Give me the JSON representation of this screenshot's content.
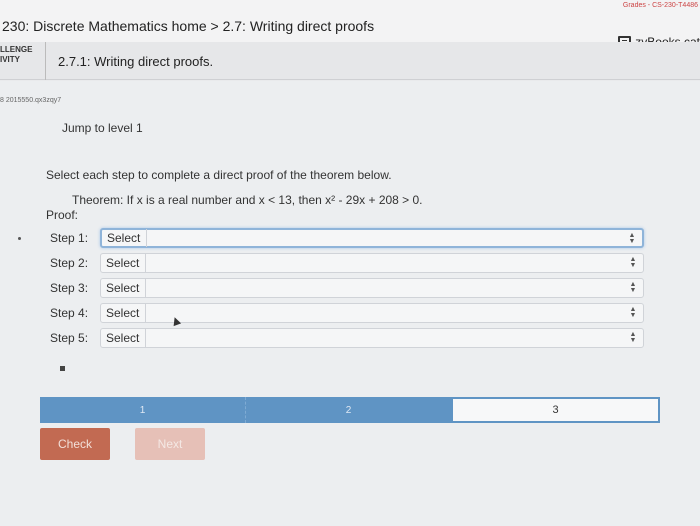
{
  "header": {
    "breadcrumb": "230: Discrete Mathematics home > 2.7: Writing direct proofs",
    "grades_link": "Grades - CS-230-T4486",
    "zybooks_label": "zyBooks cat"
  },
  "activity": {
    "badge_line1": "LLENGE",
    "badge_line2": "IVITY",
    "section_title": "2.7.1: Writing direct proofs."
  },
  "problem": {
    "id_text": "8 2015550.qx3zqy7",
    "jump_label": "Jump to level 1",
    "instruction": "Select each step to complete a direct proof of the theorem below.",
    "theorem": "Theorem: If x is a real number and x < 13, then x² - 29x + 208 > 0.",
    "proof_label": "Proof:",
    "steps": [
      {
        "label": "Step 1:",
        "value": "Select"
      },
      {
        "label": "Step 2:",
        "value": "Select"
      },
      {
        "label": "Step 3:",
        "value": "Select"
      },
      {
        "label": "Step 4:",
        "value": "Select"
      },
      {
        "label": "Step 5:",
        "value": "Select"
      }
    ]
  },
  "progress": {
    "levels": [
      "1",
      "2",
      "3"
    ],
    "current_level": 3
  },
  "buttons": {
    "check": "Check",
    "next": "Next"
  },
  "colors": {
    "accent_blue": "#5f94c4",
    "check_button": "#c26a52",
    "next_button_disabled": "#e6c0b7"
  }
}
